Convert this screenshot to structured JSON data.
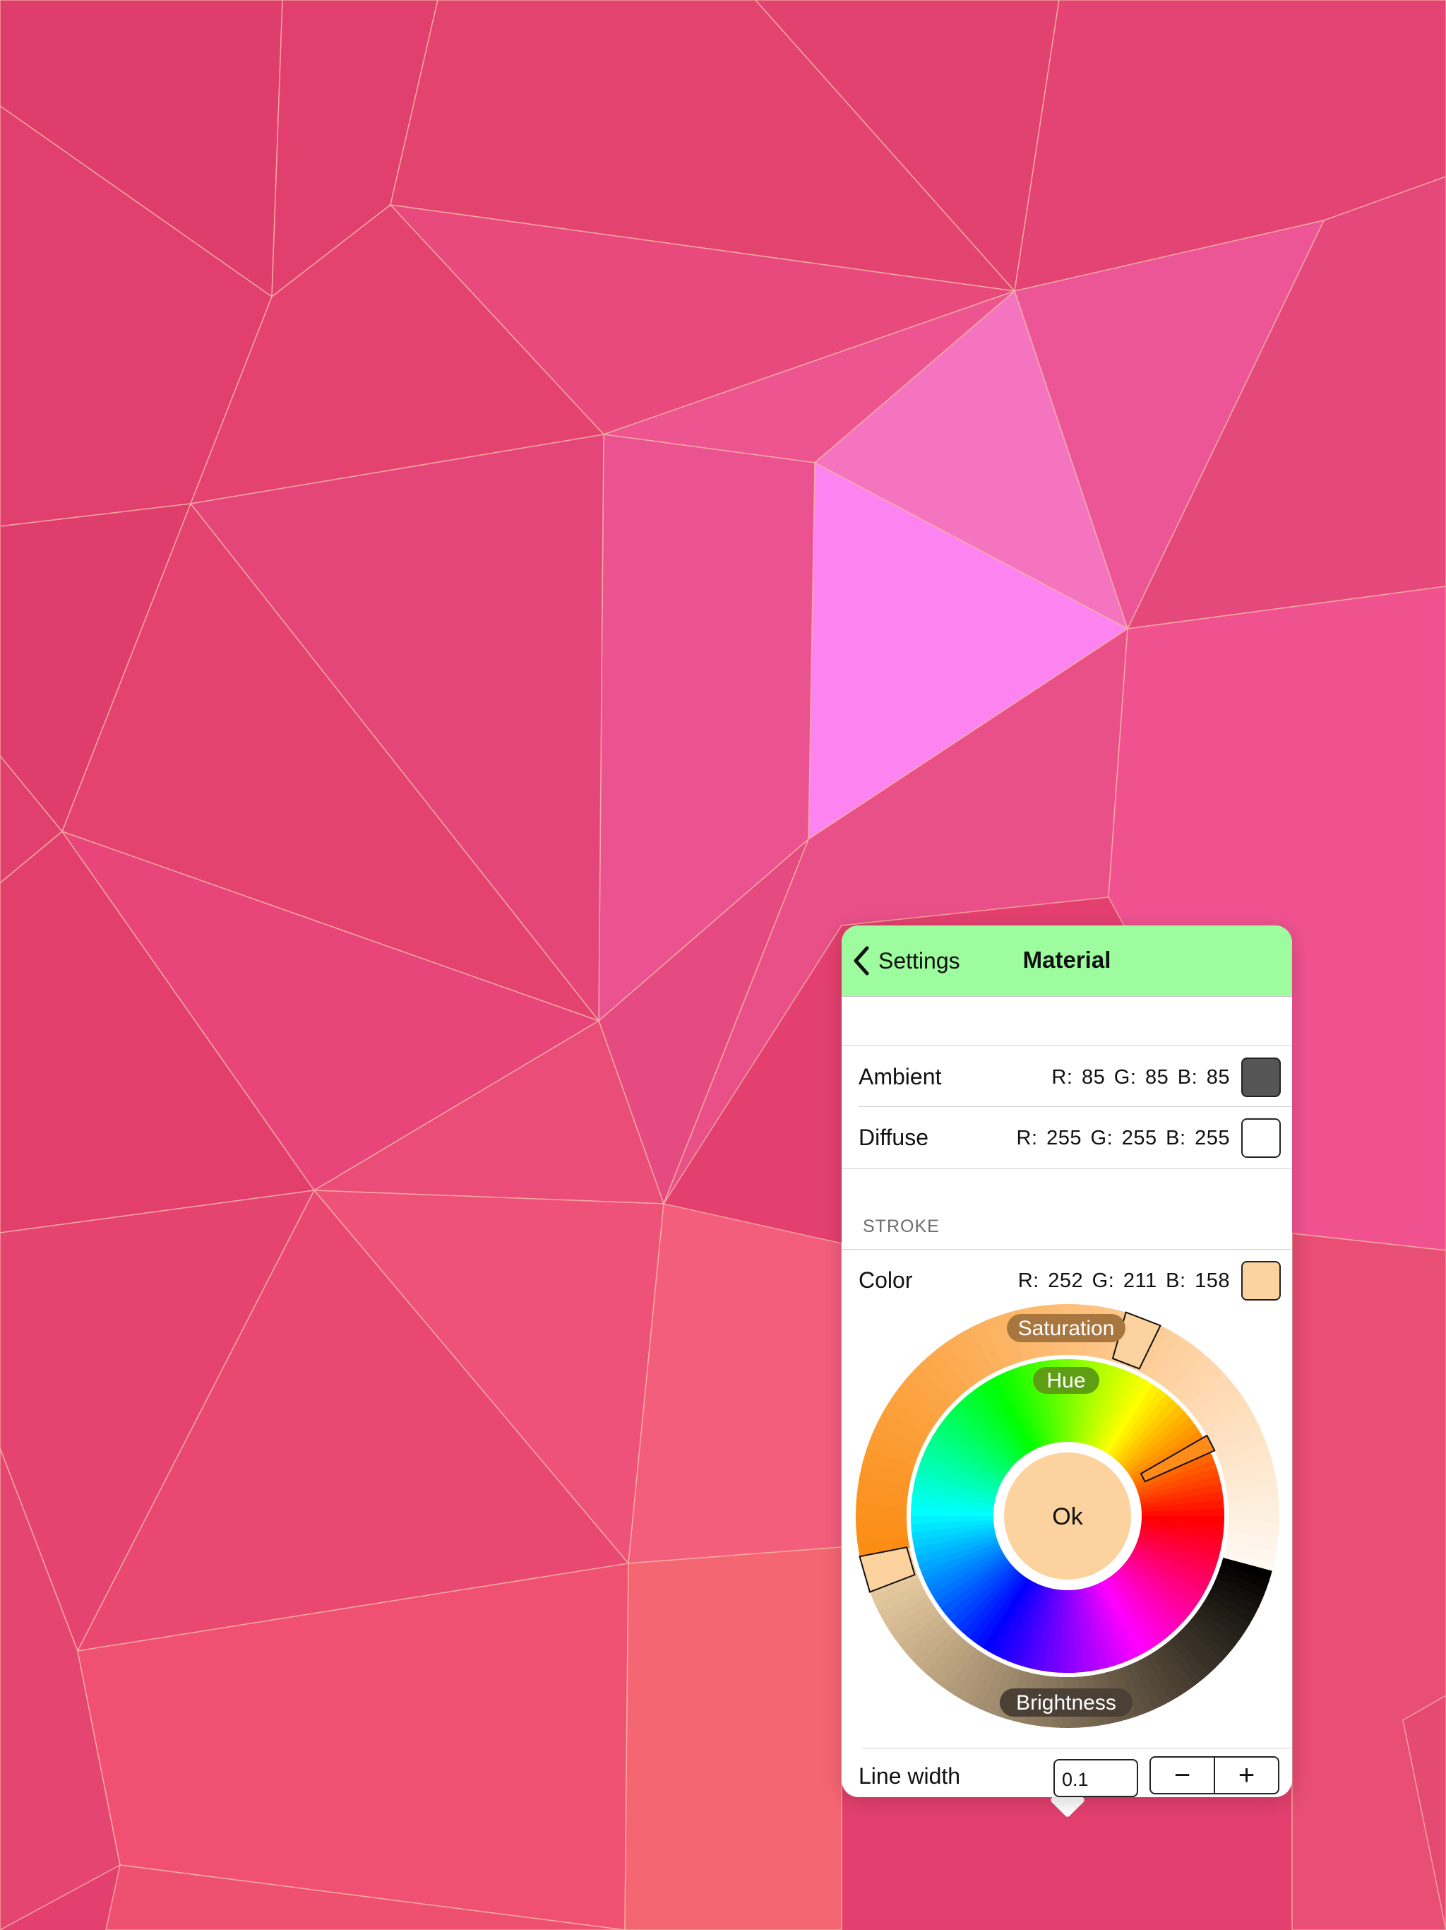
{
  "colors": {
    "background": "#e4406f",
    "navbar": "#9cfc9e",
    "ambient_swatch": "#555555",
    "diffuse_swatch": "#ffffff",
    "stroke_swatch": "#fcd39e"
  },
  "navbar": {
    "back_label": "Settings",
    "back_icon": "chevron-left-icon",
    "title": "Material"
  },
  "ambient": {
    "label": "Ambient",
    "rgb": "R: 85  G: 85  B: 85"
  },
  "diffuse": {
    "label": "Diffuse",
    "rgb": "R: 255  G: 255  B: 255"
  },
  "stroke": {
    "section_title": "STROKE",
    "color_label": "Color",
    "rgb": "R: 252  G: 211  B: 158"
  },
  "color_wheel": {
    "saturation_label": "Saturation",
    "hue_label": "Hue",
    "brightness_label": "Brightness",
    "ok_label": "Ok"
  },
  "line_width": {
    "label": "Line width",
    "value": "0.1",
    "minus_label": "−",
    "plus_label": "+"
  }
}
